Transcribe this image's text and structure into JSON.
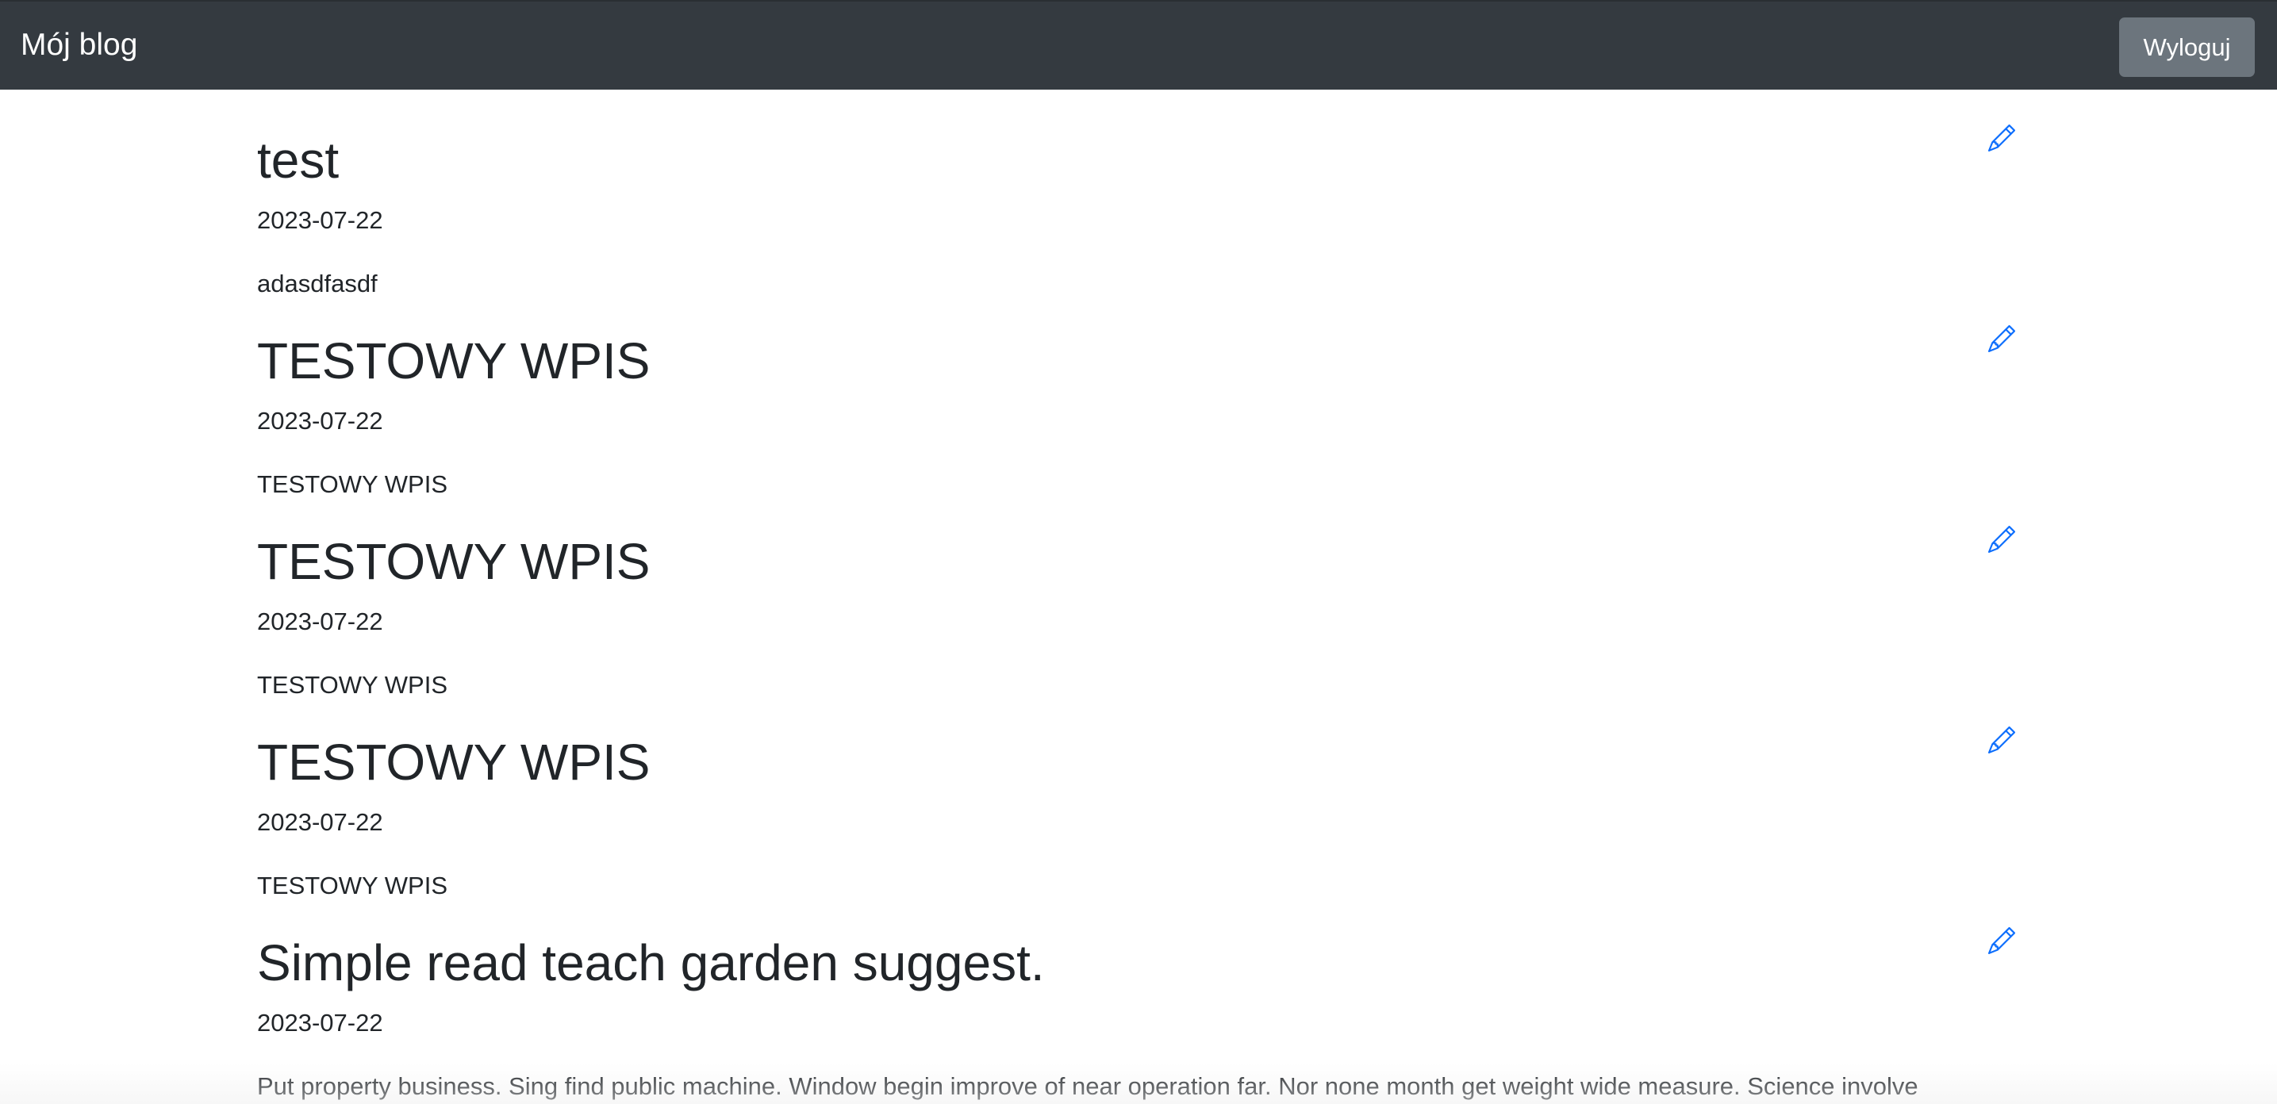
{
  "navbar": {
    "brand": "Mój blog",
    "logout_label": "Wyloguj"
  },
  "posts": [
    {
      "title": "test",
      "date": "2023-07-22",
      "body": "adasdfasdf",
      "edit_icon": "pencil-icon"
    },
    {
      "title": "TESTOWY WPIS",
      "date": "2023-07-22",
      "body": "TESTOWY WPIS",
      "edit_icon": "pencil-icon"
    },
    {
      "title": "TESTOWY WPIS",
      "date": "2023-07-22",
      "body": "TESTOWY WPIS",
      "edit_icon": "pencil-icon"
    },
    {
      "title": "TESTOWY WPIS",
      "date": "2023-07-22",
      "body": "TESTOWY WPIS",
      "edit_icon": "pencil-icon"
    },
    {
      "title": "Simple read teach garden suggest.",
      "date": "2023-07-22",
      "body": "Put property business. Sing find public machine. Window begin improve of near operation far. Nor none month get weight wide measure. Science involve",
      "edit_icon": "pencil-icon"
    }
  ],
  "colors": {
    "navbar_bg": "#343a40",
    "logout_bg": "#6c757d",
    "edit_icon": "#0d6efd",
    "text": "#212529"
  }
}
